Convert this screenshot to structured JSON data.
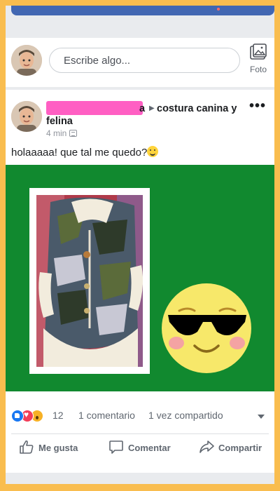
{
  "composer": {
    "placeholder": "Escribe algo...",
    "photo_label": "Foto"
  },
  "post": {
    "author_tail": "a",
    "group_name": "costura canina y felina",
    "time": "4 min",
    "text": "holaaaaa! que tal me quedo?",
    "more": "•••"
  },
  "reactions": {
    "types": [
      "like",
      "love",
      "wow"
    ],
    "count": "12",
    "comments": "1 comentario",
    "shares": "1 vez compartido"
  },
  "actions": {
    "like": "Me gusta",
    "comment": "Comentar",
    "share": "Compartir"
  },
  "colors": {
    "page_border": "#f9bd4f",
    "image_background": "#11892f",
    "redaction": "#ff5fc3",
    "facebook_blue": "#4267b2"
  }
}
